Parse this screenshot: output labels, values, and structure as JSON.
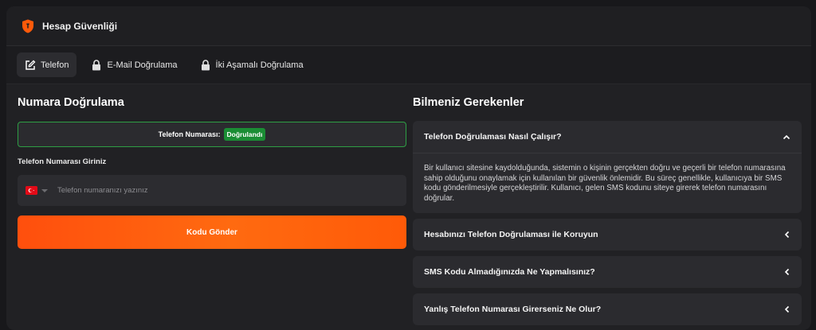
{
  "header": {
    "title": "Hesap Güvenliği",
    "icon": "shield-icon"
  },
  "tabs": [
    {
      "label": "Telefon",
      "icon": "edit-icon",
      "active": true
    },
    {
      "label": "E-Mail Doğrulama",
      "icon": "lock-icon",
      "active": false
    },
    {
      "label": "İki Aşamalı Doğrulama",
      "icon": "lock-icon",
      "active": false
    }
  ],
  "left": {
    "title": "Numara Doğrulama",
    "status_label": "Telefon Numarası:",
    "status_badge": "Doğrulandı",
    "field_label": "Telefon Numarası Giriniz",
    "phone_placeholder": "Telefon numaranızı yazınız",
    "phone_value": "",
    "send_button": "Kodu Gönder"
  },
  "right": {
    "title": "Bilmeniz Gerekenler",
    "faq": [
      {
        "question": "Telefon Doğrulaması Nasıl Çalışır?",
        "expanded": true,
        "answer": "Bir kullanıcı sitesine kaydolduğunda, sistemin o kişinin gerçekten doğru ve geçerli bir telefon numarasına sahip olduğunu onaylamak için kullanılan bir güvenlik önlemidir. Bu süreç genellikle, kullanıcıya bir SMS kodu gönderilmesiyle gerçekleştirilir. Kullanıcı, gelen SMS kodunu siteye girerek telefon numarasını doğrular."
      },
      {
        "question": "Hesabınızı Telefon Doğrulaması ile Koruyun",
        "expanded": false
      },
      {
        "question": "SMS Kodu Almadığınızda Ne Yapmalısınız?",
        "expanded": false
      },
      {
        "question": "Yanlış Telefon Numarası Girerseniz Ne Olur?",
        "expanded": false
      }
    ]
  },
  "colors": {
    "accent_orange": "#ff5a0a",
    "verified_green": "#1a8d34",
    "panel_bg": "#212124",
    "flag_red": "#e30a17"
  }
}
